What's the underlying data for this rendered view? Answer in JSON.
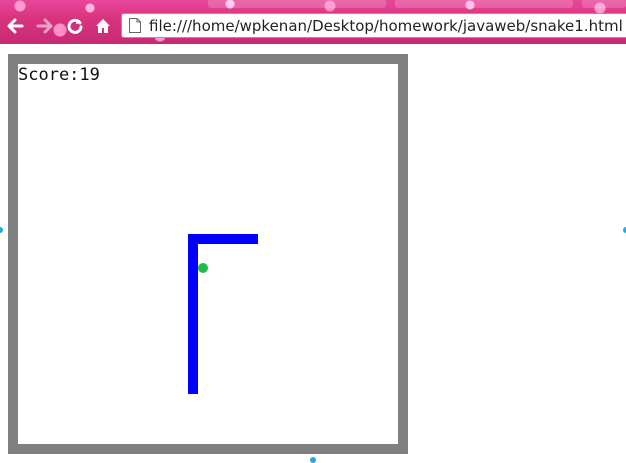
{
  "browser": {
    "url": "file:///home/wpkenan/Desktop/homework/javaweb/snake1.html",
    "theme_color": "#d9347f"
  },
  "game": {
    "score_text": "Score:19",
    "border_color": "#808080",
    "snake_color": "#0000ff",
    "food_color": "#22bb44"
  }
}
